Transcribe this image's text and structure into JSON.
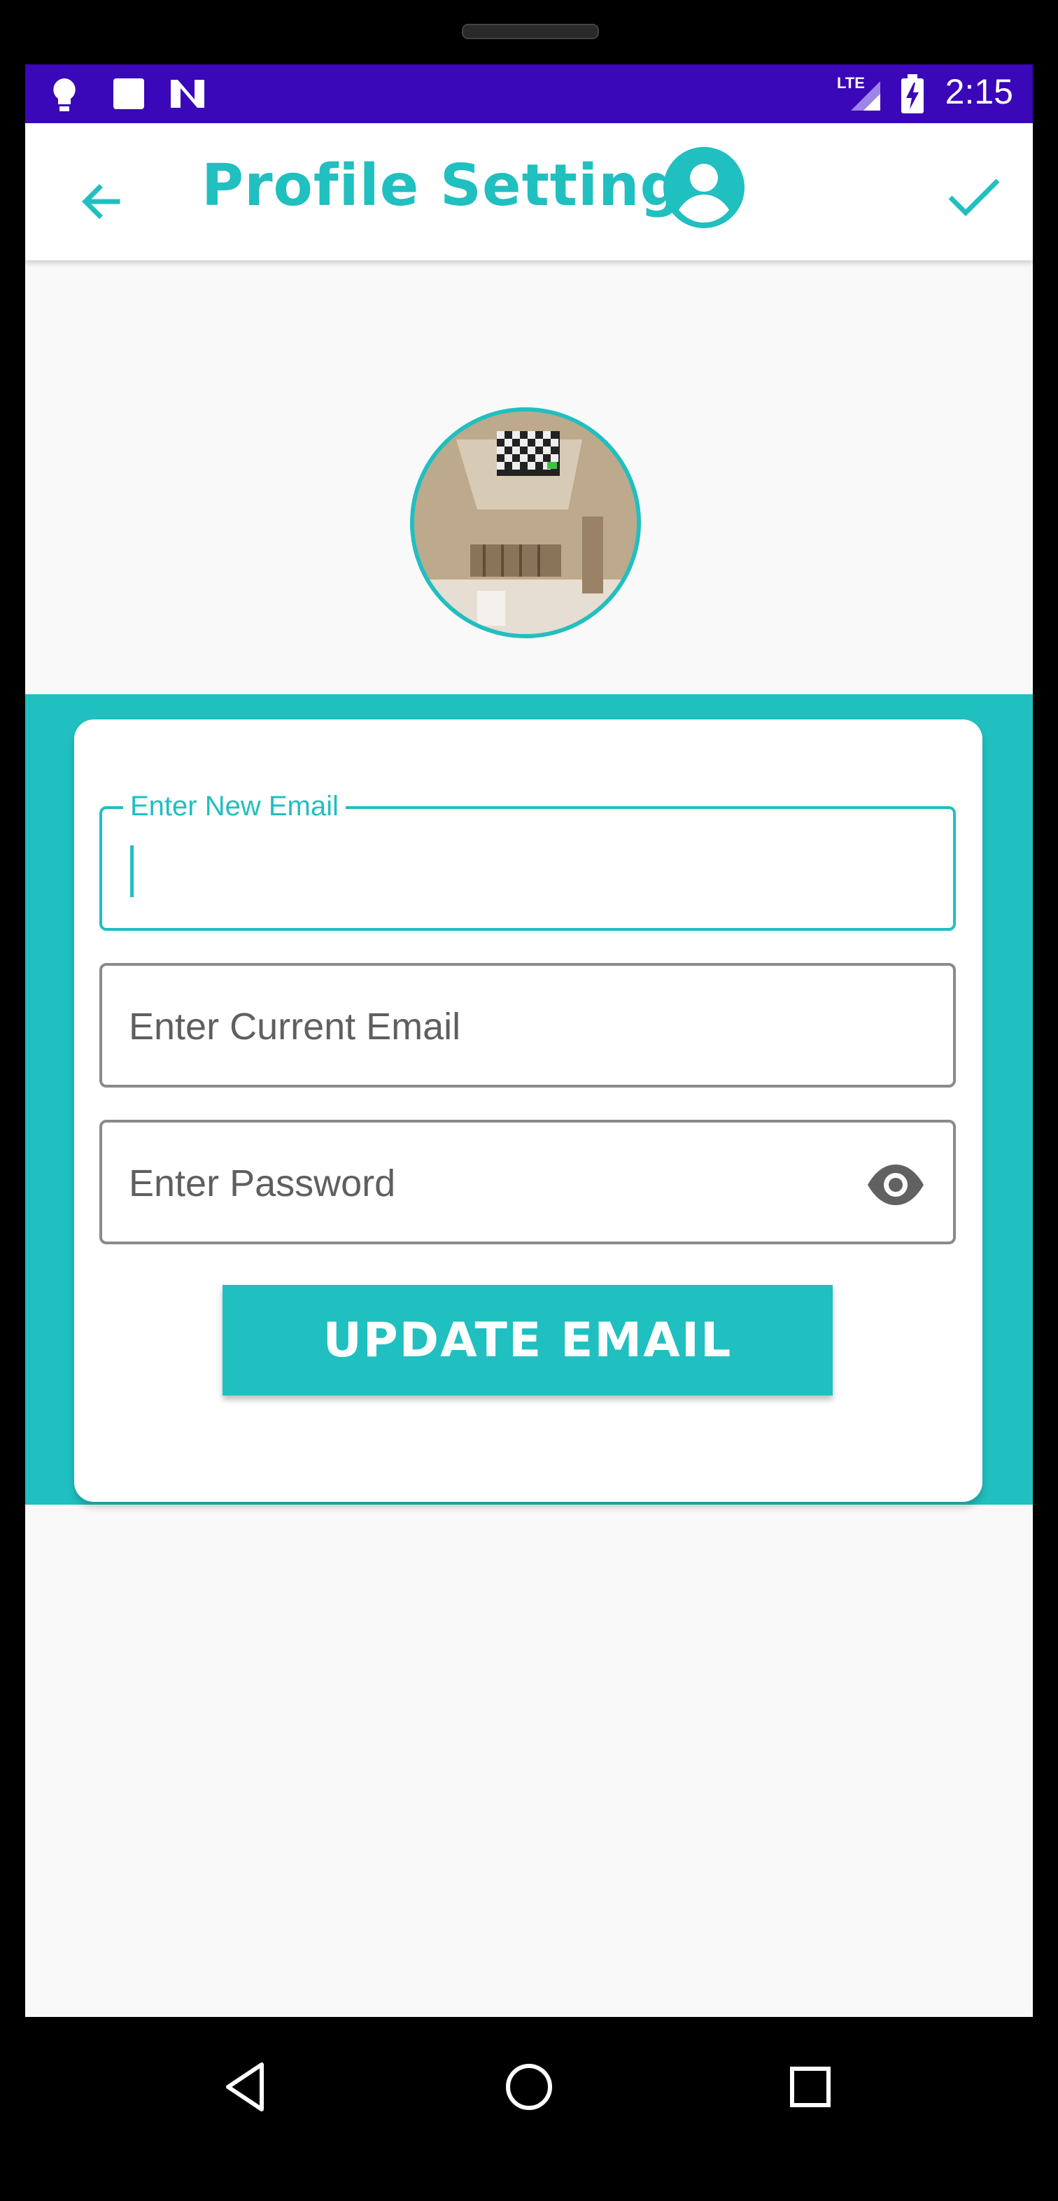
{
  "status_bar": {
    "time": "2:15",
    "network": "LTE",
    "left_icons": [
      "lightbulb-icon",
      "square-icon",
      "n-icon"
    ],
    "background": "#3a07b9"
  },
  "app_bar": {
    "title": "Profile Settings",
    "back_icon": "arrow-left-icon",
    "avatar_icon": "account-circle-icon",
    "confirm_icon": "check-icon",
    "accent": "#20bfc0"
  },
  "form": {
    "new_email": {
      "label": "Enter New Email",
      "value": ""
    },
    "current_email": {
      "placeholder": "Enter Current Email",
      "value": ""
    },
    "password": {
      "placeholder": "Enter Password",
      "value": "",
      "toggle_icon": "eye-icon"
    },
    "submit_label": "UPDATE EMAIL"
  },
  "nav_bar": {
    "icons": [
      "back-triangle-icon",
      "home-circle-icon",
      "recents-square-icon"
    ]
  }
}
